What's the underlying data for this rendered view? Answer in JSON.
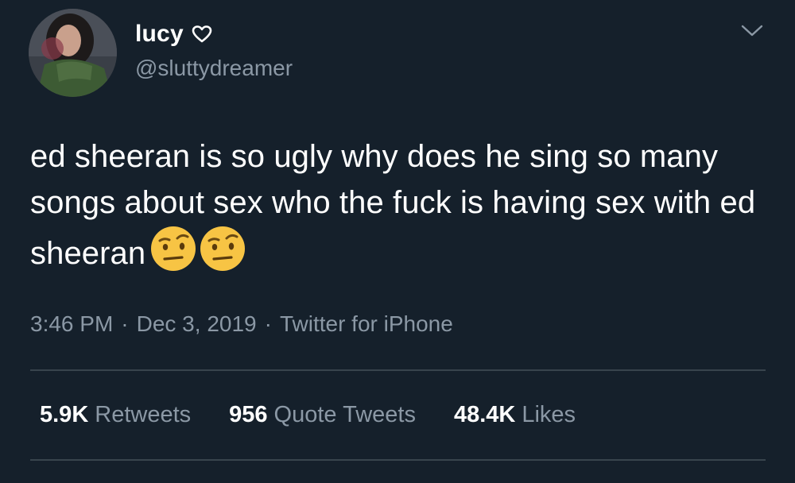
{
  "user": {
    "display_name": "lucy",
    "handle": "@sluttydreamer"
  },
  "tweet": {
    "text": "ed sheeran is so ugly why does he sing so many songs about sex who the fuck is having sex with ed sheeran",
    "emojis": [
      "face-with-raised-eyebrow-icon",
      "face-with-raised-eyebrow-icon"
    ]
  },
  "meta": {
    "time": "3:46 PM",
    "date": "Dec 3, 2019",
    "source": "Twitter for iPhone",
    "separator": "·"
  },
  "stats": [
    {
      "value": "5.9K",
      "label": "Retweets"
    },
    {
      "value": "956",
      "label": "Quote Tweets"
    },
    {
      "value": "48.4K",
      "label": "Likes"
    }
  ],
  "colors": {
    "background": "#15202b",
    "primary_text": "#ffffff",
    "secondary_text": "#8b98a5",
    "divider": "#38444d",
    "emoji": "#f7c444"
  }
}
